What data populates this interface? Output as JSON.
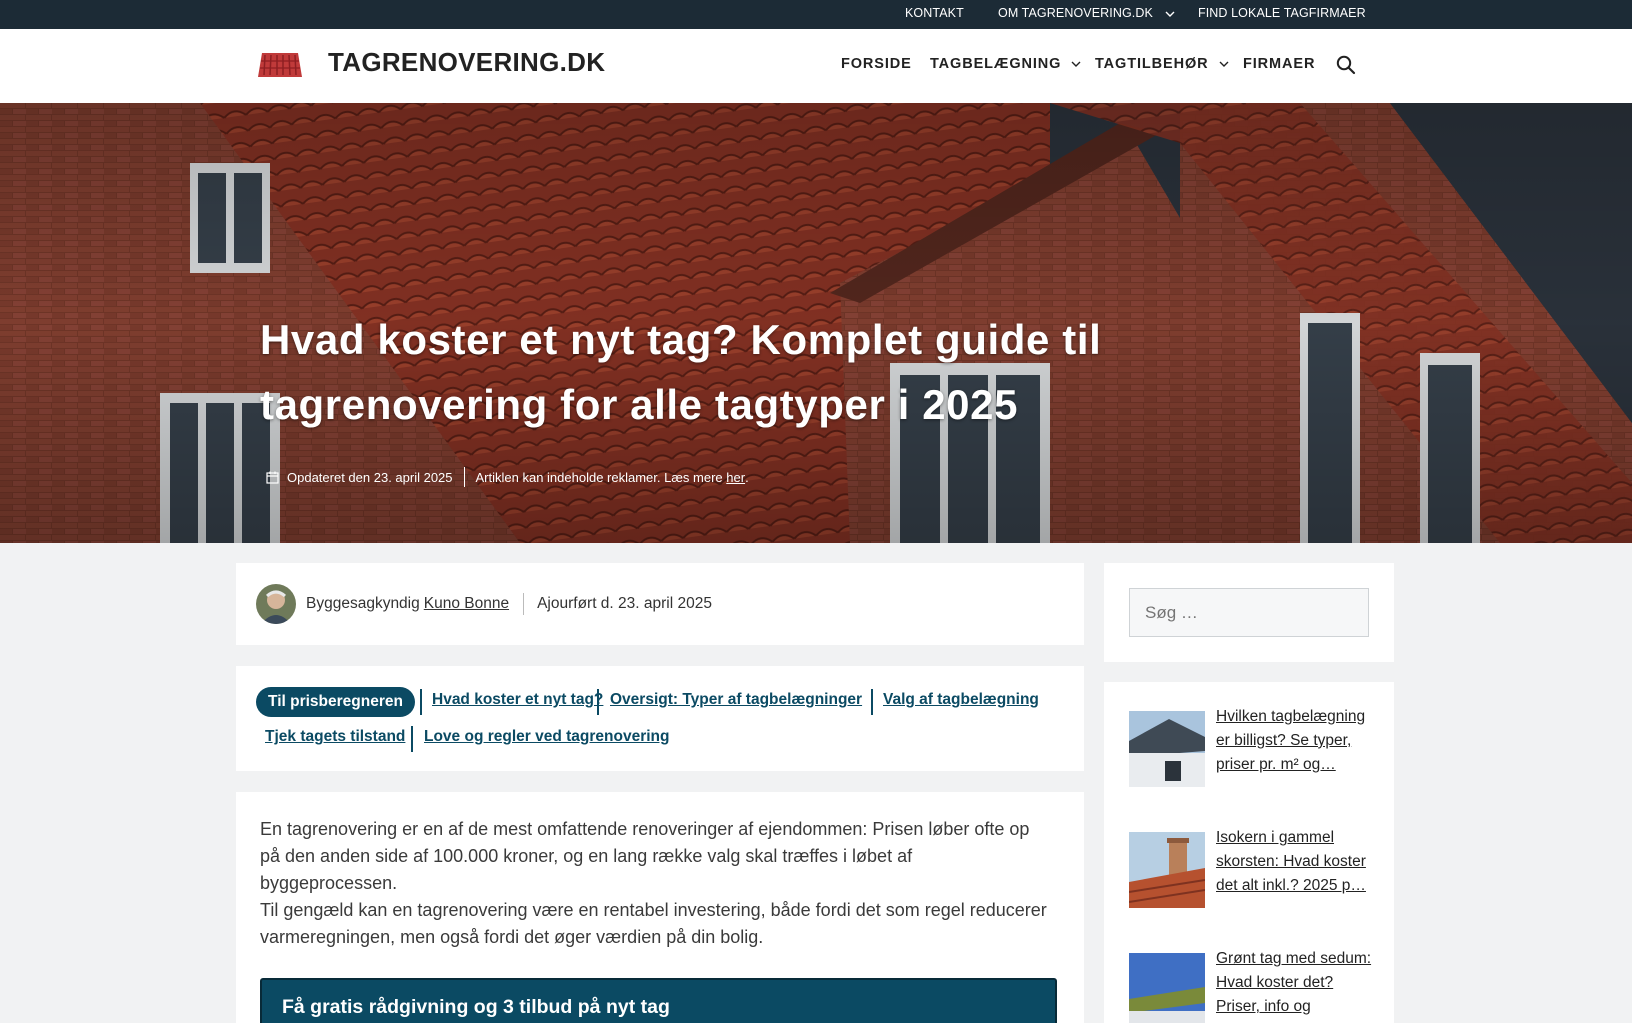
{
  "topbar": {
    "links": [
      "KONTAKT",
      "OM TAGRENOVERING.DK",
      "FIND LOKALE TAGFIRMAER"
    ]
  },
  "header": {
    "site_title": "TAGRENOVERING.DK",
    "logo_icon": "roof-tiles-icon",
    "nav": [
      "FORSIDE",
      "TAGBELÆGNING",
      "TAGTILBEHØR",
      "FIRMAER"
    ],
    "search_icon": "search-icon"
  },
  "hero": {
    "title": "Hvad koster et nyt tag? Komplet guide til tagrenovering for alle tagtyper i 2025",
    "updated": "Opdateret den 23. april 2025",
    "ad_notice": "Artiklen kan indeholde reklamer. Læs mere",
    "ad_link": "her",
    "ad_period": "."
  },
  "author": {
    "role": "Byggesagkyndig",
    "name": "Kuno Bonne",
    "updated": "Ajourført d. 23. april 2025"
  },
  "toc": {
    "pill": "Til prisberegneren",
    "links": [
      "Hvad koster et nyt tag?",
      "Oversigt: Typer af tagbelægninger",
      "Valg af tagbelægning",
      "Tjek tagets tilstand",
      "Love og regler ved tagrenovering"
    ]
  },
  "article": {
    "p1": "En tagrenovering er en af de mest omfattende renoveringer af ejendommen: Prisen løber ofte op på den anden side af 100.000 kroner, og en lang række valg skal træffes i løbet af byggeprocessen.",
    "p2": "Til gengæld kan en tagrenovering være en rentabel investering, både fordi det som regel reducerer varmeregningen, men også fordi det øger værdien på din bolig.",
    "cta": "Få gratis rådgivning og 3 tilbud på nyt tag"
  },
  "sidebar": {
    "search_placeholder": "Søg …",
    "related": [
      {
        "title": "Hvilken tagbelægning er billigst? Se typer, priser pr. m² og…"
      },
      {
        "title": "Isokern i gammel skorsten: Hvad koster det alt inkl.? 2025 p…"
      },
      {
        "title": "Grønt tag med sedum: Hvad koster det? Priser, info og"
      }
    ]
  },
  "colors": {
    "topbar": "#1c2b36",
    "accent": "#0b4a63",
    "roof": "#b8482f"
  }
}
